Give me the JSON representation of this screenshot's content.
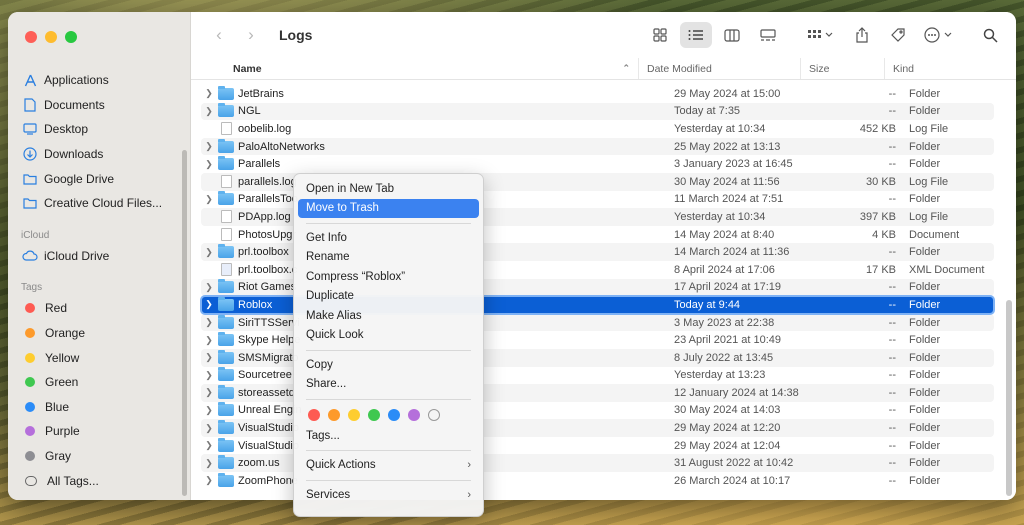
{
  "window": {
    "title": "Logs"
  },
  "sidebar": {
    "favorites": [
      {
        "label": "Applications",
        "icon": "applications-icon"
      },
      {
        "label": "Documents",
        "icon": "document-icon"
      },
      {
        "label": "Desktop",
        "icon": "desktop-icon"
      },
      {
        "label": "Downloads",
        "icon": "download-icon"
      },
      {
        "label": "Google Drive",
        "icon": "folder-icon"
      },
      {
        "label": "Creative Cloud Files...",
        "icon": "folder-icon"
      }
    ],
    "icloud_heading": "iCloud",
    "icloud": [
      {
        "label": "iCloud Drive",
        "icon": "cloud-icon"
      }
    ],
    "tags_heading": "Tags",
    "tags": [
      {
        "label": "Red",
        "color": "#fe5b52"
      },
      {
        "label": "Orange",
        "color": "#fd9a2b"
      },
      {
        "label": "Yellow",
        "color": "#fecd2f"
      },
      {
        "label": "Green",
        "color": "#3fc850"
      },
      {
        "label": "Blue",
        "color": "#2b8cf7"
      },
      {
        "label": "Purple",
        "color": "#b56fdb"
      },
      {
        "label": "Gray",
        "color": "#8e8e93"
      },
      {
        "label": "All Tags...",
        "color": ""
      }
    ]
  },
  "columns": {
    "name": "Name",
    "date": "Date Modified",
    "size": "Size",
    "kind": "Kind"
  },
  "files": [
    {
      "name": "JetBrains",
      "type": "folder",
      "date": "29 May 2024 at 15:00",
      "size": "--",
      "kind": "Folder"
    },
    {
      "name": "NGL",
      "type": "folder",
      "date": "Today at 7:35",
      "size": "--",
      "kind": "Folder"
    },
    {
      "name": "oobelib.log",
      "type": "doc",
      "date": "Yesterday at 10:34",
      "size": "452 KB",
      "kind": "Log File"
    },
    {
      "name": "PaloAltoNetworks",
      "type": "folder",
      "date": "25 May 2022 at 13:13",
      "size": "--",
      "kind": "Folder"
    },
    {
      "name": "Parallels",
      "type": "folder",
      "date": "3 January 2023 at 16:45",
      "size": "--",
      "kind": "Folder"
    },
    {
      "name": "parallels.log",
      "type": "doc",
      "date": "30 May 2024 at 11:56",
      "size": "30 KB",
      "kind": "Log File"
    },
    {
      "name": "ParallelsToo",
      "type": "folder",
      "date": "11 March 2024 at 7:51",
      "size": "--",
      "kind": "Folder"
    },
    {
      "name": "PDApp.log",
      "type": "doc",
      "date": "Yesterday at 10:34",
      "size": "397 KB",
      "kind": "Log File"
    },
    {
      "name": "PhotosUpgr",
      "type": "doc",
      "date": "14 May 2024 at 8:40",
      "size": "4 KB",
      "kind": "Document"
    },
    {
      "name": "prl.toolbox",
      "type": "folder",
      "date": "14 March 2024 at 11:36",
      "size": "--",
      "kind": "Folder"
    },
    {
      "name": "prl.toolbox.c",
      "type": "xml",
      "date": "8 April 2024 at 17:06",
      "size": "17 KB",
      "kind": "XML Document"
    },
    {
      "name": "Riot Games",
      "type": "folder",
      "date": "17 April 2024 at 17:19",
      "size": "--",
      "kind": "Folder"
    },
    {
      "name": "Roblox",
      "type": "folder",
      "date": "Today at 9:44",
      "size": "--",
      "kind": "Folder",
      "selected": true
    },
    {
      "name": "SiriTTSServi",
      "type": "folder",
      "date": "3 May 2023 at 22:38",
      "size": "--",
      "kind": "Folder"
    },
    {
      "name": "Skype Helpe",
      "type": "folder",
      "date": "23 April 2021 at 10:49",
      "size": "--",
      "kind": "Folder"
    },
    {
      "name": "SMSMigrato",
      "type": "folder",
      "date": "8 July 2022 at 13:45",
      "size": "--",
      "kind": "Folder"
    },
    {
      "name": "Sourcetree",
      "type": "folder",
      "date": "Yesterday at 13:23",
      "size": "--",
      "kind": "Folder"
    },
    {
      "name": "storeassetd",
      "type": "folder",
      "date": "12 January 2024 at 14:38",
      "size": "--",
      "kind": "Folder"
    },
    {
      "name": "Unreal Engin",
      "type": "folder",
      "date": "30 May 2024 at 14:03",
      "size": "--",
      "kind": "Folder"
    },
    {
      "name": "VisualStudio",
      "type": "folder",
      "date": "29 May 2024 at 12:20",
      "size": "--",
      "kind": "Folder"
    },
    {
      "name": "VisualStudio",
      "type": "folder",
      "date": "29 May 2024 at 12:04",
      "size": "--",
      "kind": "Folder"
    },
    {
      "name": "zoom.us",
      "type": "folder",
      "date": "31 August 2022 at 10:42",
      "size": "--",
      "kind": "Folder"
    },
    {
      "name": "ZoomPhone",
      "type": "folder",
      "date": "26 March 2024 at 10:17",
      "size": "--",
      "kind": "Folder"
    }
  ],
  "context_menu": {
    "groups": [
      [
        {
          "label": "Open in New Tab"
        },
        {
          "label": "Move to Trash",
          "highlighted": true
        }
      ],
      [
        {
          "label": "Get Info"
        },
        {
          "label": "Rename"
        },
        {
          "label": "Compress “Roblox”"
        },
        {
          "label": "Duplicate"
        },
        {
          "label": "Make Alias"
        },
        {
          "label": "Quick Look"
        }
      ],
      [
        {
          "label": "Copy"
        },
        {
          "label": "Share..."
        }
      ]
    ],
    "tag_colors": [
      "#fe5b52",
      "#fd9a2b",
      "#fecd2f",
      "#3fc850",
      "#2b8cf7",
      "#b56fdb",
      ""
    ],
    "tags_label": "Tags...",
    "quick_actions": "Quick Actions",
    "services": "Services"
  }
}
